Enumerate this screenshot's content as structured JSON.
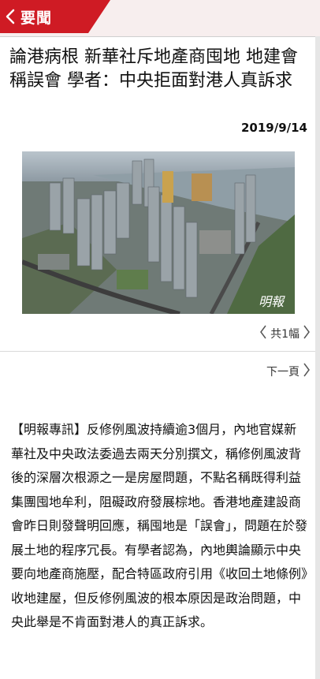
{
  "header": {
    "section_label": "要聞",
    "back_icon": "chevron-left-icon"
  },
  "article": {
    "headline": "論港病根 新華社斥地產商囤地 地建會稱誤會 學者：中央拒面對港人真訴求",
    "date": "2019/9/14",
    "image_watermark": "明報",
    "gallery_count": "共1幅",
    "next_page": "下一頁",
    "body": "【明報專訊】反修例風波持續逾3個月，內地官媒新華社及中央政法委過去兩天分別撰文，稱修例風波背後的深層次根源之一是房屋問題，不點名稱既得利益集團囤地牟利，阻礙政府發展棕地。香港地產建設商會昨日則發聲明回應，稱囤地是「誤會」，問題在於發展土地的程序冗長。有學者認為，內地輿論顯示中央要向地產商施壓，配合特區政府引用《收回土地條例》收地建屋，但反修例風波的根本原因是政治問題，中央此舉是不肯面對港人的真正訴求。"
  },
  "colors": {
    "accent": "#cf1b24",
    "header_bg": "#f7eeee"
  }
}
